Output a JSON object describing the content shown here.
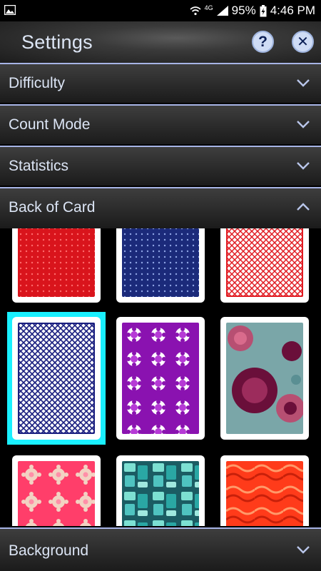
{
  "status_bar": {
    "network": "4G",
    "battery": "95%",
    "time": "4:46 PM"
  },
  "header": {
    "title": "Settings",
    "help_label": "?",
    "close_label": "✕"
  },
  "sections": [
    {
      "label": "Difficulty",
      "expanded": false
    },
    {
      "label": "Count Mode",
      "expanded": false
    },
    {
      "label": "Statistics",
      "expanded": false
    },
    {
      "label": "Back of Card",
      "expanded": true
    },
    {
      "label": "Background",
      "expanded": false
    }
  ],
  "card_backs": {
    "selected_index": 3,
    "items": [
      {
        "name": "red-diamond",
        "colors": [
          "#d9141c",
          "#ff7a7a"
        ]
      },
      {
        "name": "blue-diamond",
        "colors": [
          "#1b2a7a",
          "#8fa5e6"
        ]
      },
      {
        "name": "red-lattice",
        "colors": [
          "#e11b22",
          "#ffffff"
        ]
      },
      {
        "name": "navy-lattice",
        "colors": [
          "#1a1f80",
          "#ffffff"
        ]
      },
      {
        "name": "purple-floral",
        "colors": [
          "#8a12b0",
          "#ffffff"
        ]
      },
      {
        "name": "teal-bubbles",
        "colors": [
          "#7aa6a8",
          "#6a0f3a"
        ]
      },
      {
        "name": "pink-flowers",
        "colors": [
          "#ff3e6a",
          "#f2d2c2"
        ]
      },
      {
        "name": "teal-retro",
        "colors": [
          "#2aa7a4",
          "#7de0d2"
        ]
      },
      {
        "name": "red-waves",
        "colors": [
          "#ff3b1a",
          "#ff9a6a"
        ]
      }
    ]
  }
}
